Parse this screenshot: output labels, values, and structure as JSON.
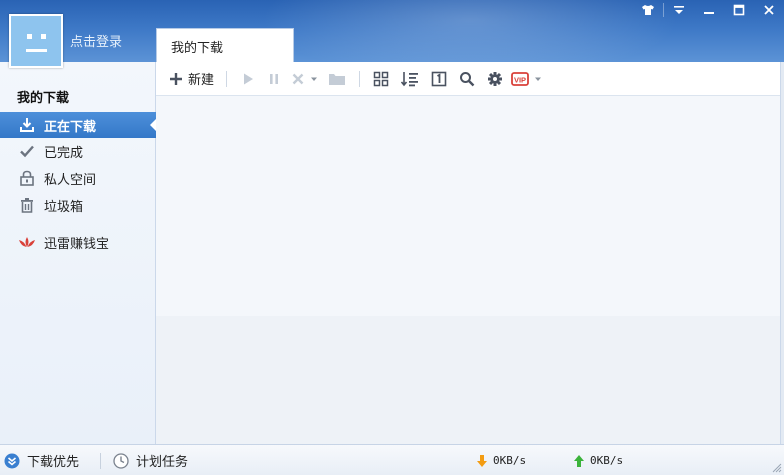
{
  "user": {
    "login_label": "点击登录"
  },
  "tab": {
    "label": "我的下载"
  },
  "sidebar": {
    "title": "我的下载",
    "items": [
      {
        "label": "正在下载",
        "icon": "download-icon"
      },
      {
        "label": "已完成",
        "icon": "checkmark-icon"
      },
      {
        "label": "私人空间",
        "icon": "lock-icon"
      },
      {
        "label": "垃圾箱",
        "icon": "trash-icon"
      },
      {
        "label": "迅雷赚钱宝",
        "icon": "lotus-icon"
      }
    ]
  },
  "toolbar": {
    "new_label": "新建",
    "vip_label": "VIP"
  },
  "statusbar": {
    "priority_label": "下载优先",
    "schedule_label": "计划任务",
    "down_speed": "0KB/s",
    "up_speed": "0KB/s"
  },
  "colors": {
    "header": "#3d78c6",
    "active_item": "#3d82cf",
    "accent_orange": "#f39c12",
    "accent_green": "#3bb33b",
    "vip_red": "#d9413a"
  }
}
